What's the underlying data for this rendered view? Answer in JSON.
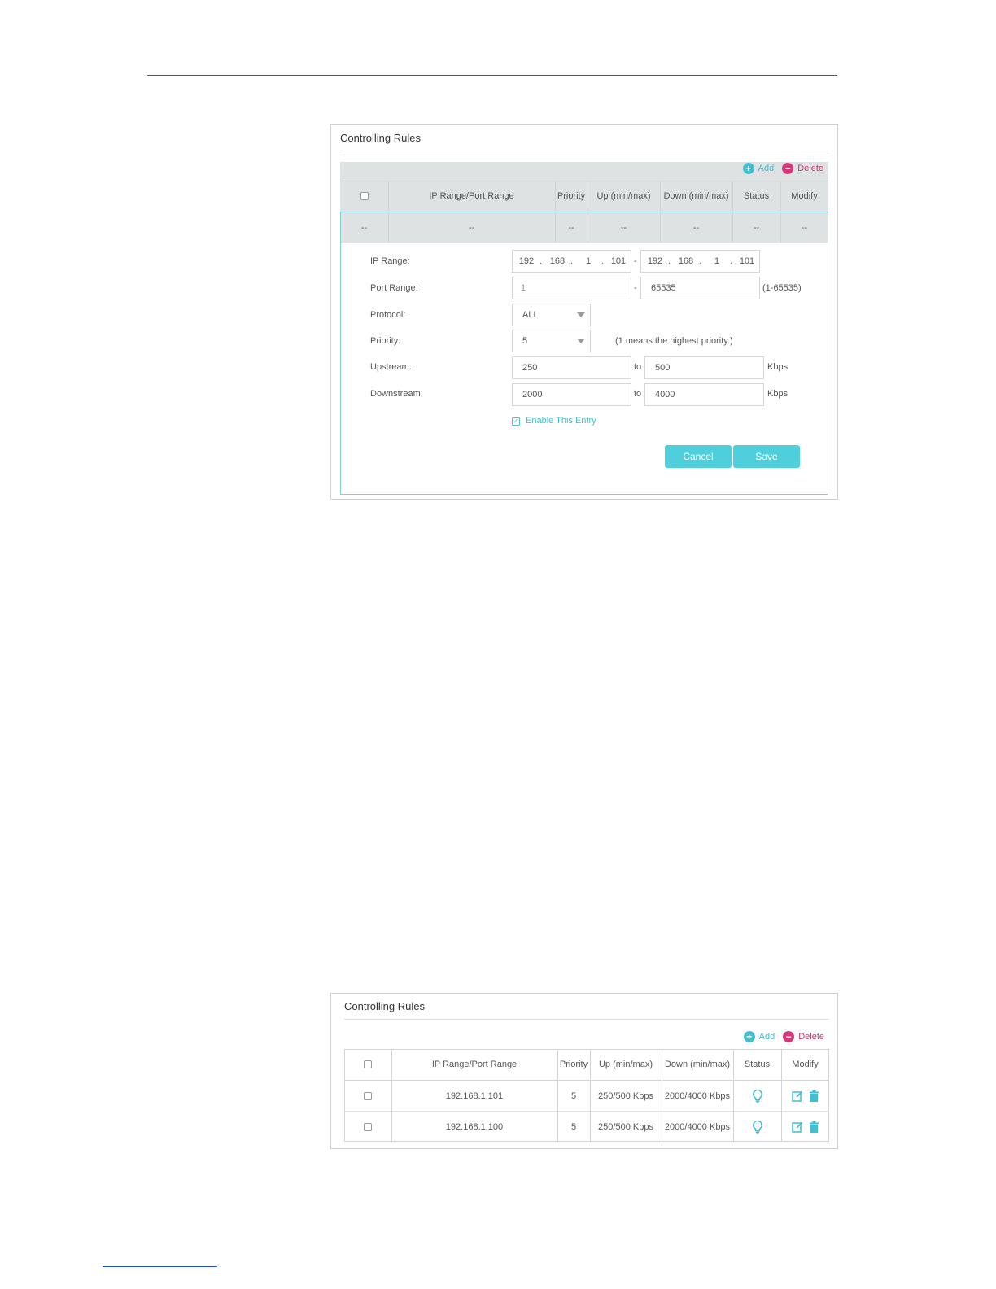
{
  "panel1": {
    "title": "Controlling Rules",
    "add_label": "Add",
    "delete_label": "Delete",
    "columns": [
      "IP Range/Port Range",
      "Priority",
      "Up (min/max)",
      "Down (min/max)",
      "Status",
      "Modify"
    ],
    "placeholder_row": [
      "--",
      "--",
      "--",
      "--",
      "--",
      "--",
      "--"
    ],
    "form": {
      "ip_range_label": "IP Range:",
      "ip_start": [
        "192",
        "168",
        "1",
        "101"
      ],
      "ip_end": [
        "192",
        "168",
        "1",
        "101"
      ],
      "dash": "-",
      "port_range_label": "Port Range:",
      "port_start": "1",
      "port_end": "65535",
      "port_hint": "(1-65535)",
      "protocol_label": "Protocol:",
      "protocol_value": "ALL",
      "priority_label": "Priority:",
      "priority_value": "5",
      "priority_hint": "(1 means the highest priority.)",
      "upstream_label": "Upstream:",
      "upstream_min": "250",
      "upstream_max": "500",
      "downstream_label": "Downstream:",
      "downstream_min": "2000",
      "downstream_max": "4000",
      "to": "to",
      "unit": "Kbps",
      "enable_label": "Enable This Entry",
      "enable_checked": true,
      "cancel_label": "Cancel",
      "save_label": "Save"
    }
  },
  "panel2": {
    "title": "Controlling Rules",
    "add_label": "Add",
    "delete_label": "Delete",
    "columns": [
      "IP Range/Port Range",
      "Priority",
      "Up (min/max)",
      "Down (min/max)",
      "Status",
      "Modify"
    ],
    "rows": [
      {
        "ip": "192.168.1.101",
        "priority": "5",
        "up": "250/500 Kbps",
        "down": "2000/4000 Kbps",
        "status_icon": "bulb-icon"
      },
      {
        "ip": "192.168.1.100",
        "priority": "5",
        "up": "250/500 Kbps",
        "down": "2000/4000 Kbps",
        "status_icon": "bulb-icon"
      }
    ]
  },
  "colors": {
    "accent": "#4fcfdc",
    "delete": "#d3387a"
  }
}
